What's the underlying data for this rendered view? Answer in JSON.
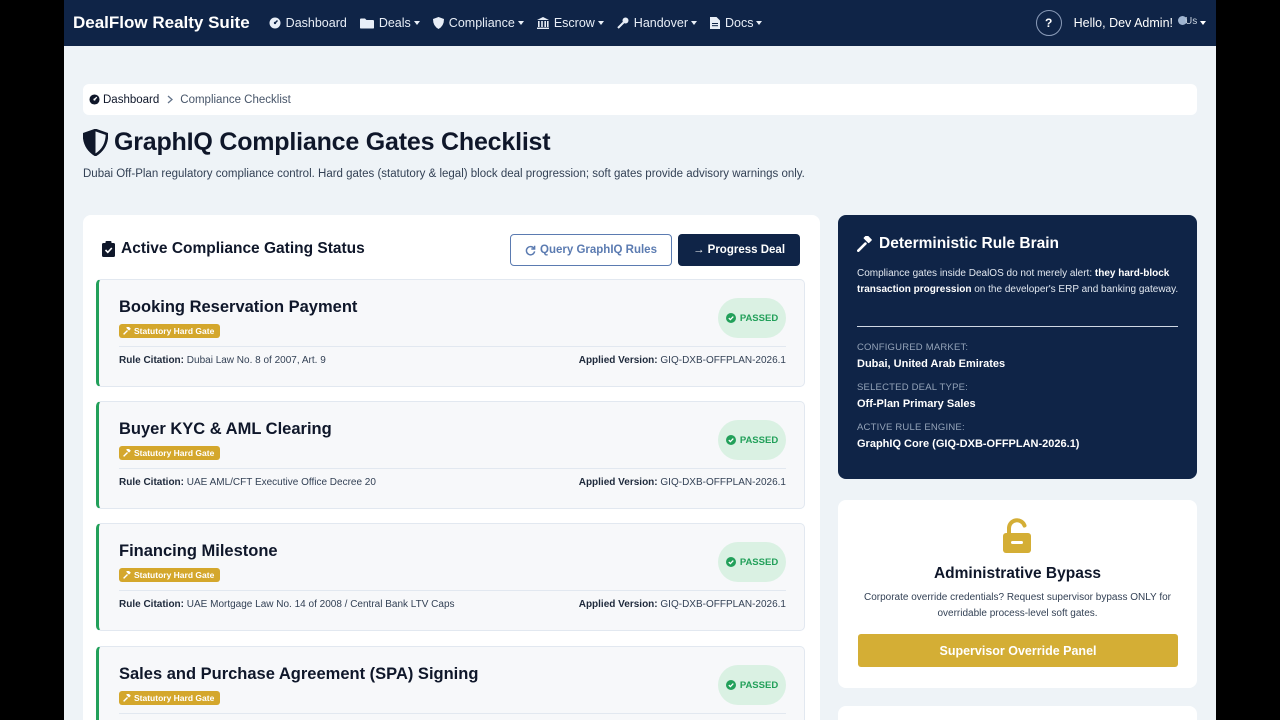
{
  "navbar": {
    "brand": "DealFlow Realty Suite",
    "items": [
      {
        "label": "Dashboard",
        "icon": "dashboard-gauge-icon",
        "dropdown": false
      },
      {
        "label": "Deals",
        "icon": "folder-icon",
        "dropdown": true
      },
      {
        "label": "Compliance",
        "icon": "shield-icon",
        "dropdown": true
      },
      {
        "label": "Escrow",
        "icon": "bank-icon",
        "dropdown": true
      },
      {
        "label": "Handover",
        "icon": "key-icon",
        "dropdown": true
      },
      {
        "label": "Docs",
        "icon": "file-icon",
        "dropdown": true
      }
    ],
    "help_label": "?",
    "greeting": "Hello, Dev Admin!",
    "avatar_alt": "Us"
  },
  "breadcrumb": {
    "home": "Dashboard",
    "current": "Compliance Checklist"
  },
  "page": {
    "title": "GraphIQ Compliance Gates Checklist",
    "subtitle": "Dubai Off-Plan regulatory compliance control. Hard gates (statutory & legal) block deal progression; soft gates provide advisory warnings only."
  },
  "gating": {
    "heading": "Active Compliance Gating Status",
    "query_button": "Query GraphIQ Rules",
    "progress_button": "→ Progress Deal",
    "rule_label": "Rule Citation:",
    "version_label": "Applied Version:",
    "gates": [
      {
        "title": "Booking Reservation Payment",
        "badge": "Statutory Hard Gate",
        "citation": "Dubai Law No. 8 of 2007, Art. 9",
        "version": "GIQ-DXB-OFFPLAN-2026.1",
        "status": "PASSED"
      },
      {
        "title": "Buyer KYC & AML Clearing",
        "badge": "Statutory Hard Gate",
        "citation": "UAE AML/CFT Executive Office Decree 20",
        "version": "GIQ-DXB-OFFPLAN-2026.1",
        "status": "PASSED"
      },
      {
        "title": "Financing Milestone",
        "badge": "Statutory Hard Gate",
        "citation": "UAE Mortgage Law No. 14 of 2008 / Central Bank LTV Caps",
        "version": "GIQ-DXB-OFFPLAN-2026.1",
        "status": "PASSED"
      },
      {
        "title": "Sales and Purchase Agreement (SPA) Signing",
        "badge": "Statutory Hard Gate",
        "citation": "",
        "version": "",
        "status": "PASSED"
      }
    ]
  },
  "rule_brain": {
    "heading": "Deterministic Rule Brain",
    "desc_start": "Compliance gates inside DealOS do not merely alert: ",
    "desc_bold": "they hard-block transaction progression",
    "desc_end": " on the developer's ERP and banking gateway.",
    "market_label": "CONFIGURED MARKET:",
    "market_value": "Dubai, United Arab Emirates",
    "deal_type_label": "SELECTED DEAL TYPE:",
    "deal_type_value": "Off-Plan Primary Sales",
    "engine_label": "ACTIVE RULE ENGINE:",
    "engine_value": "GraphIQ Core (GIQ-DXB-OFFPLAN-2026.1)"
  },
  "bypass": {
    "heading": "Administrative Bypass",
    "text": "Corporate override credentials? Request supervisor bypass ONLY for overridable process-level soft gates.",
    "button": "Supervisor Override Panel"
  },
  "colors": {
    "navy": "#0f2447",
    "passed_green": "#22a05a",
    "gold": "#d4a72c",
    "outline_blue": "#5b7bb1"
  }
}
